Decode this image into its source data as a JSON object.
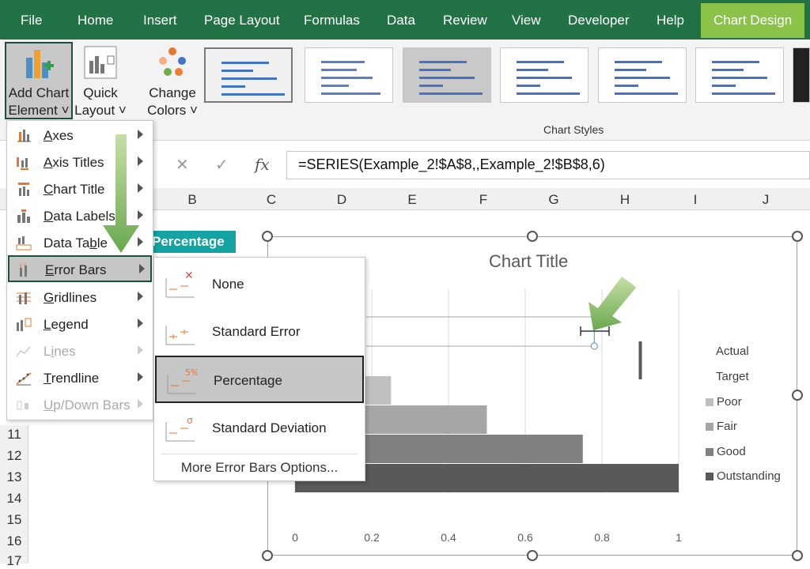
{
  "ribbon_tabs": [
    "File",
    "Home",
    "Insert",
    "Page Layout",
    "Formulas",
    "Data",
    "Review",
    "View",
    "Developer",
    "Help",
    "Chart Design"
  ],
  "active_tab": "Chart Design",
  "ribbon": {
    "add_chart_element": [
      "Add Chart",
      "Element ˅"
    ],
    "quick_layout": [
      "Quick",
      "Layout ˅"
    ],
    "change_colors": [
      "Change",
      "Colors ˅"
    ],
    "chart_styles_label": "Chart Styles"
  },
  "formula_bar": {
    "fx": "fx",
    "formula": "=SERIES(Example_2!$A$8,,Example_2!$B$8,6)"
  },
  "columns": [
    "B",
    "C",
    "D",
    "E",
    "F",
    "G",
    "H",
    "I",
    "J"
  ],
  "rows": [
    "11",
    "12",
    "13",
    "14",
    "15",
    "16",
    "17"
  ],
  "cell": {
    "percentage_header": "Percentage"
  },
  "chart": {
    "title": "Chart Title",
    "x_ticks": [
      "0",
      "0.2",
      "0.4",
      "0.6",
      "0.8",
      "1"
    ],
    "legend": [
      {
        "label": "Actual",
        "color": ""
      },
      {
        "label": "Target",
        "color": ""
      },
      {
        "label": "Poor",
        "color": "#bfbfbf"
      },
      {
        "label": "Fair",
        "color": "#a6a6a6"
      },
      {
        "label": "Good",
        "color": "#808080"
      },
      {
        "label": "Outstanding",
        "color": "#595959"
      }
    ]
  },
  "chart_data": {
    "type": "bar",
    "title": "Chart Title",
    "xlabel": "",
    "ylabel": "",
    "xlim": [
      0,
      1
    ],
    "series": [
      {
        "name": "Poor",
        "value": 0.25,
        "color": "#bfbfbf"
      },
      {
        "name": "Fair",
        "value": 0.5,
        "color": "#a6a6a6"
      },
      {
        "name": "Good",
        "value": 0.75,
        "color": "#808080"
      },
      {
        "name": "Outstanding",
        "value": 1.0,
        "color": "#595959"
      }
    ],
    "actual_marker": 0.9,
    "target_error_bar": 0.78,
    "legend_position": "right",
    "grid": true
  },
  "menu": {
    "items": [
      {
        "label": "Axes",
        "ul": "A",
        "disabled": false
      },
      {
        "label": "Axis Titles",
        "ul": "A",
        "disabled": false
      },
      {
        "label": "Chart Title",
        "ul": "C",
        "disabled": false
      },
      {
        "label": "Data Labels",
        "ul": "D",
        "disabled": false
      },
      {
        "label": "Data Table",
        "ul": "b",
        "disabled": false
      },
      {
        "label": "Error Bars",
        "ul": "E",
        "disabled": false
      },
      {
        "label": "Gridlines",
        "ul": "G",
        "disabled": false
      },
      {
        "label": "Legend",
        "ul": "L",
        "disabled": false
      },
      {
        "label": "Lines",
        "ul": "i",
        "disabled": true
      },
      {
        "label": "Trendline",
        "ul": "T",
        "disabled": false
      },
      {
        "label": "Up/Down Bars",
        "ul": "U",
        "disabled": true
      }
    ],
    "highlighted": "Error Bars"
  },
  "submenu": {
    "items": [
      "None",
      "Standard Error",
      "Percentage",
      "Standard Deviation"
    ],
    "highlighted": "Percentage",
    "icon_badges": {
      "None": "✕",
      "Percentage": "5%",
      "Standard Deviation": "σ"
    },
    "more": "More Error Bars Options..."
  }
}
